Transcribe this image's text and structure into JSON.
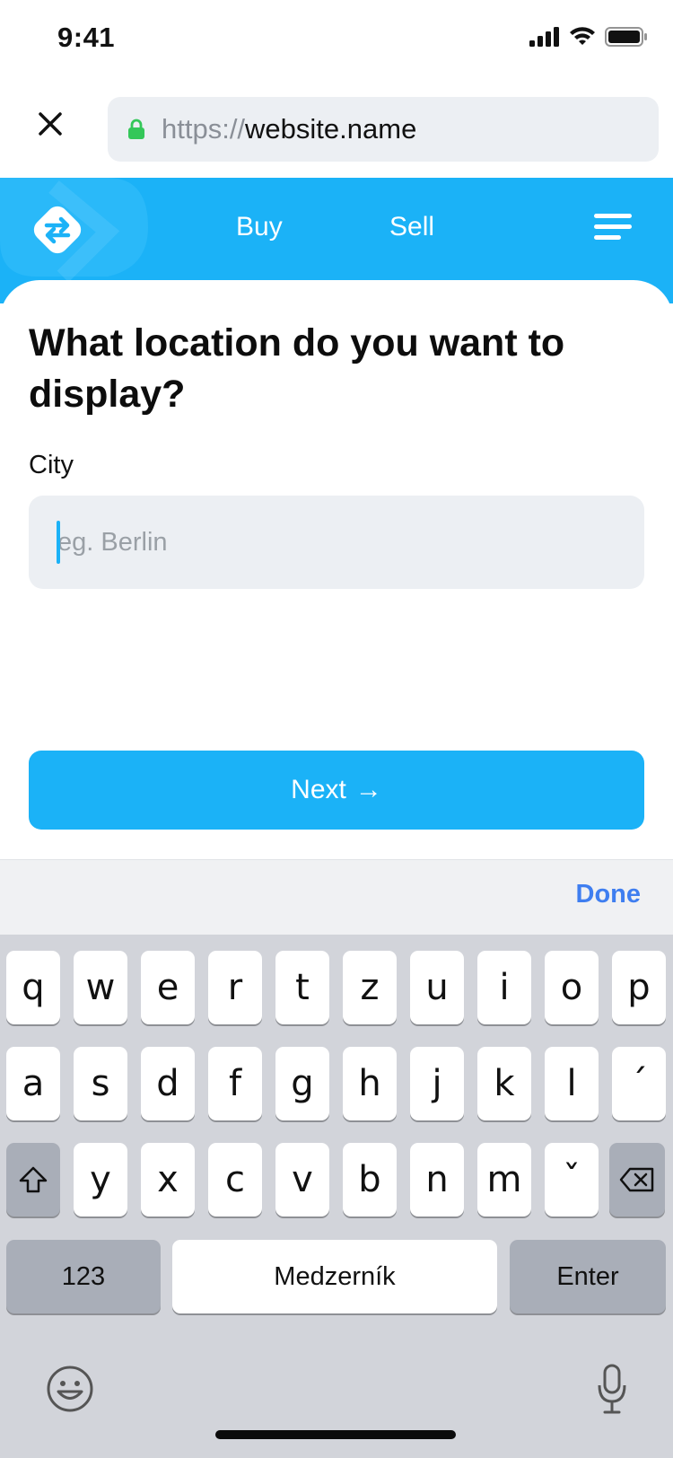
{
  "status_bar": {
    "time": "9:41"
  },
  "browser": {
    "url_scheme": "https://",
    "url_host": "website.name"
  },
  "header": {
    "nav_buy": "Buy",
    "nav_sell": "Sell"
  },
  "form": {
    "question": "What location do you want to display?",
    "city_label": "City",
    "city_placeholder": "eg. Berlin",
    "city_value": "",
    "next_label": "Next",
    "next_arrow": "→"
  },
  "keyboard": {
    "done_label": "Done",
    "row1": [
      "q",
      "w",
      "e",
      "r",
      "t",
      "z",
      "u",
      "i",
      "o",
      "p"
    ],
    "row2": [
      "a",
      "s",
      "d",
      "f",
      "g",
      "h",
      "j",
      "k",
      "l",
      "´"
    ],
    "row3": [
      "y",
      "x",
      "c",
      "v",
      "b",
      "n",
      "m",
      "ˇ"
    ],
    "numbers_label": "123",
    "space_label": "Medzerník",
    "enter_label": "Enter"
  },
  "colors": {
    "accent": "#1bb2f7",
    "done": "#3f7ef0",
    "input_bg": "#eceff3"
  }
}
